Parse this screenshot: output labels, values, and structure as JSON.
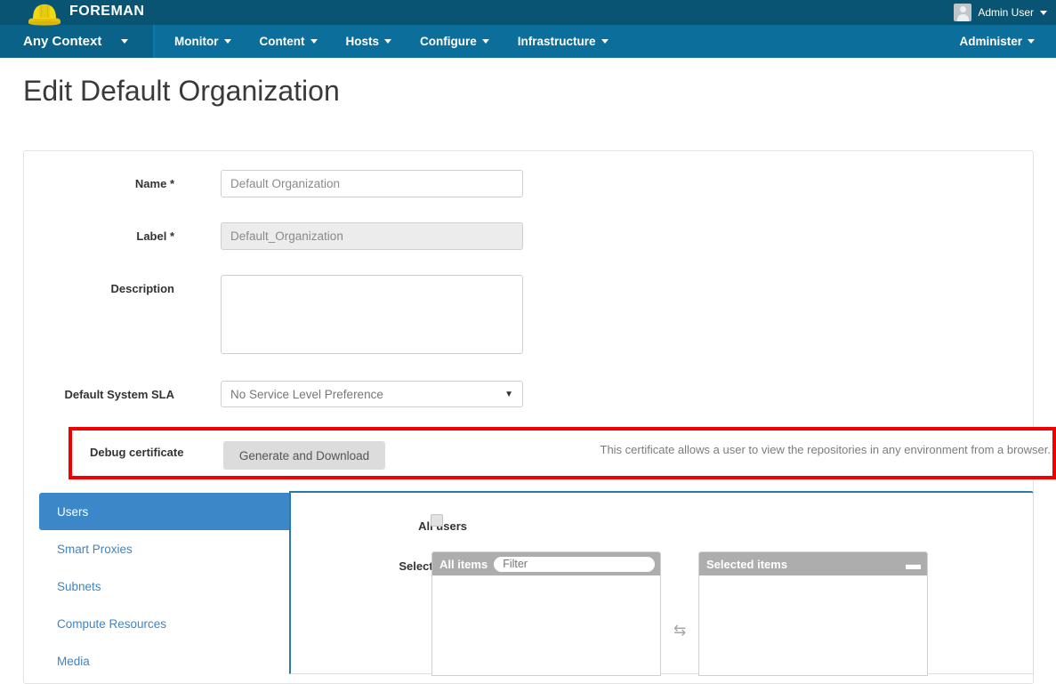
{
  "brand": {
    "name": "FOREMAN",
    "logo_icon": "hard-hat-icon"
  },
  "topbar": {
    "user_label": "Admin User",
    "avatar_icon": "user-avatar-icon",
    "caret_icon": "caret-down-icon"
  },
  "navbar": {
    "context_label": "Any Context",
    "items": [
      {
        "label": "Monitor"
      },
      {
        "label": "Content"
      },
      {
        "label": "Hosts"
      },
      {
        "label": "Configure"
      },
      {
        "label": "Infrastructure"
      }
    ],
    "administer_label": "Administer"
  },
  "page": {
    "title": "Edit Default Organization"
  },
  "form": {
    "name": {
      "label": "Name *",
      "value": "Default Organization",
      "placeholder": "Default Organization"
    },
    "label_field": {
      "label": "Label *",
      "value": "Default_Organization",
      "placeholder": "Default_Organization"
    },
    "description": {
      "label": "Description",
      "value": "",
      "placeholder": ""
    },
    "sla": {
      "label": "Default System SLA",
      "selected": "No Service Level Preference",
      "arrow_icon": "select-arrow-icon"
    },
    "debug_certificate": {
      "label": "Debug certificate",
      "button_label": "Generate and Download",
      "help_text": "This certificate allows a user to view the repositories in any environment from a browser.",
      "highlight_color": "#f20000"
    }
  },
  "tabs": {
    "items": [
      {
        "label": "Users",
        "active": true
      },
      {
        "label": "Smart Proxies",
        "active": false
      },
      {
        "label": "Subnets",
        "active": false
      },
      {
        "label": "Compute Resources",
        "active": false
      },
      {
        "label": "Media",
        "active": false
      }
    ],
    "active_color": "#3b87c8"
  },
  "users_panel": {
    "all_users_label": "All users",
    "all_users_checked": false,
    "select_users_label": "Select users",
    "all_items": {
      "title": "All items",
      "filter_placeholder": "Filter",
      "filter_value": "",
      "add_icon": "plus-icon",
      "items": []
    },
    "selected_items": {
      "title": "Selected items",
      "remove_icon": "minus-icon",
      "items": []
    },
    "swap_icon": "left-right-arrows-icon"
  }
}
